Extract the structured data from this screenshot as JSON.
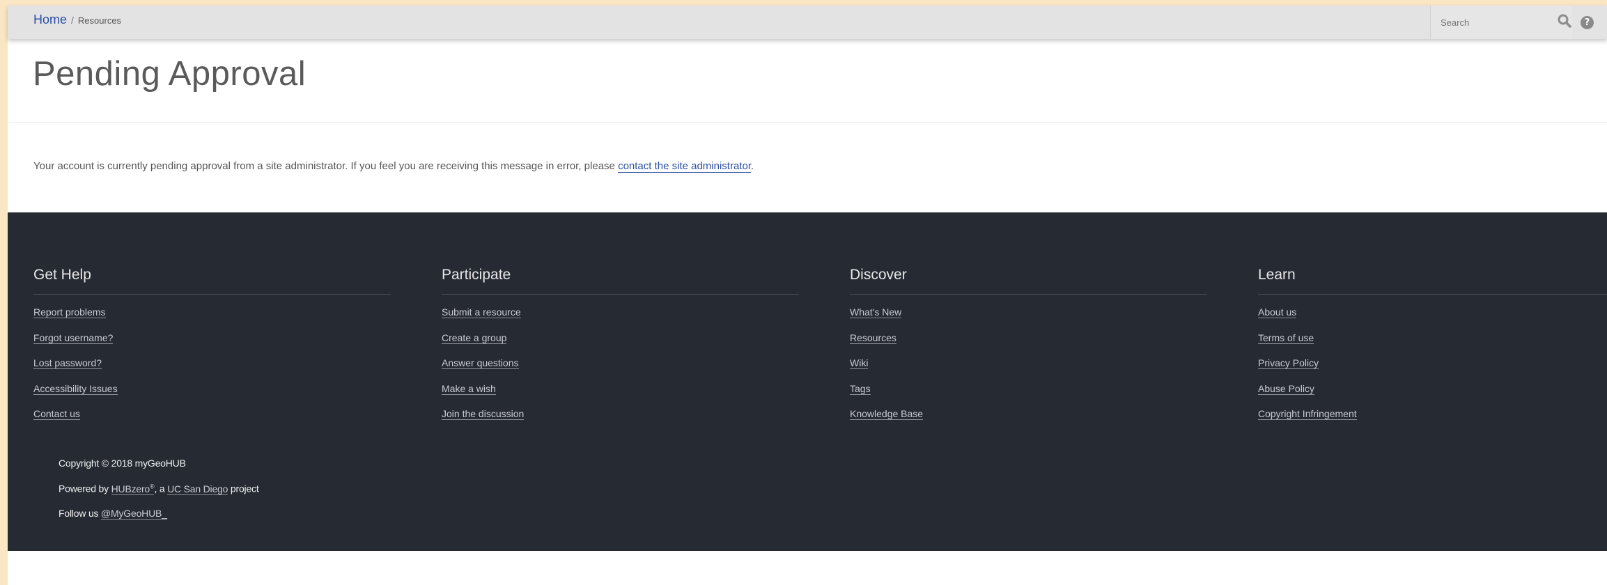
{
  "breadcrumb": {
    "home": "Home",
    "separator": "/",
    "current": "Resources"
  },
  "search": {
    "placeholder": "Search",
    "icon": "search-icon",
    "help_icon_glyph": "?"
  },
  "page": {
    "title": "Pending Approval",
    "message_text": "Your account is currently pending approval from a site administrator. If you feel you are receiving this message in error, please ",
    "message_link": "contact the site administrator",
    "message_end": "."
  },
  "footer": {
    "columns": [
      {
        "heading": "Get Help",
        "links": [
          "Report problems",
          "Forgot username?",
          "Lost password?",
          "Accessibility Issues",
          "Contact us"
        ]
      },
      {
        "heading": "Participate",
        "links": [
          "Submit a resource",
          "Create a group",
          "Answer questions",
          "Make a wish",
          "Join the discussion"
        ]
      },
      {
        "heading": "Discover",
        "links": [
          "What's New",
          "Resources",
          "Wiki",
          "Tags",
          "Knowledge Base"
        ]
      },
      {
        "heading": "Learn",
        "links": [
          "About us",
          "Terms of use",
          "Privacy Policy",
          "Abuse Policy",
          "Copyright Infringement"
        ]
      }
    ],
    "copyright": "Copyright © 2018 myGeoHUB",
    "powered_prefix": "Powered by ",
    "powered_link1": "HUBzero",
    "powered_reg": "®",
    "powered_middle": ", a ",
    "powered_link2": "UC San Diego",
    "powered_suffix": " project",
    "follow_prefix": "Follow us ",
    "follow_link": "@MyGeoHUB_"
  },
  "colors": {
    "background": "#fbe6c4",
    "topbar": "#e3e3e3",
    "footer": "#262a33",
    "link": "#2a4fa3"
  }
}
